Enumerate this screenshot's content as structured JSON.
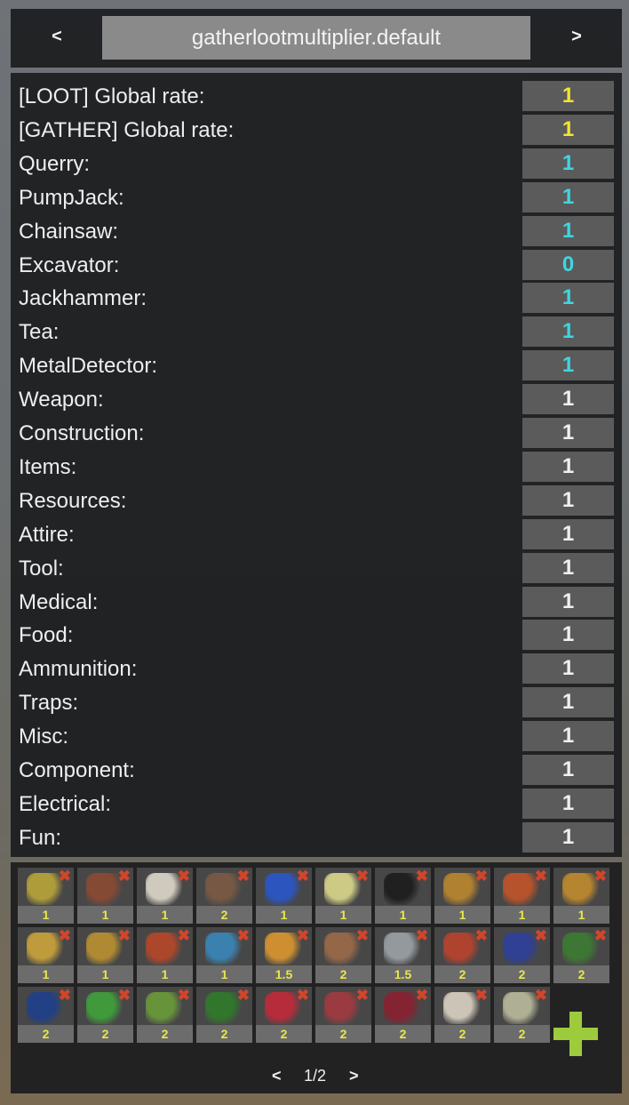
{
  "header": {
    "prev": "<",
    "title": "gatherlootmultiplier.default",
    "next": ">"
  },
  "colors": {
    "yellow": "#f2e433",
    "cyan": "#3fd6e0",
    "white": "#f0f0f0",
    "accent_add": "#9ccb3c",
    "qty_text": "#e8e74a",
    "remove": "#d2452b"
  },
  "rates": [
    {
      "label": "[LOOT] Global rate:",
      "value": "1",
      "color": "yellow"
    },
    {
      "label": "[GATHER] Global rate:",
      "value": "1",
      "color": "yellow"
    },
    {
      "label": "Querry:",
      "value": "1",
      "color": "cyan"
    },
    {
      "label": "PumpJack:",
      "value": "1",
      "color": "cyan"
    },
    {
      "label": "Chainsaw:",
      "value": "1",
      "color": "cyan"
    },
    {
      "label": "Excavator:",
      "value": "0",
      "color": "cyan"
    },
    {
      "label": "Jackhammer:",
      "value": "1",
      "color": "cyan"
    },
    {
      "label": "Tea:",
      "value": "1",
      "color": "cyan"
    },
    {
      "label": "MetalDetector:",
      "value": "1",
      "color": "cyan"
    },
    {
      "label": "Weapon:",
      "value": "1",
      "color": "white"
    },
    {
      "label": "Construction:",
      "value": "1",
      "color": "white"
    },
    {
      "label": "Items:",
      "value": "1",
      "color": "white"
    },
    {
      "label": "Resources:",
      "value": "1",
      "color": "white"
    },
    {
      "label": "Attire:",
      "value": "1",
      "color": "white"
    },
    {
      "label": "Tool:",
      "value": "1",
      "color": "white"
    },
    {
      "label": "Medical:",
      "value": "1",
      "color": "white"
    },
    {
      "label": "Food:",
      "value": "1",
      "color": "white"
    },
    {
      "label": "Ammunition:",
      "value": "1",
      "color": "white"
    },
    {
      "label": "Traps:",
      "value": "1",
      "color": "white"
    },
    {
      "label": "Misc:",
      "value": "1",
      "color": "white"
    },
    {
      "label": "Component:",
      "value": "1",
      "color": "white"
    },
    {
      "label": "Electrical:",
      "value": "1",
      "color": "white"
    },
    {
      "label": "Fun:",
      "value": "1",
      "color": "white"
    }
  ],
  "items": [
    {
      "icon": "seeds-pile-icon",
      "qty": "1",
      "color": "#b7a43a"
    },
    {
      "icon": "bear-skull-icon",
      "qty": "1",
      "color": "#8a4a33"
    },
    {
      "icon": "human-skull-icon",
      "qty": "1",
      "color": "#dcd6c8"
    },
    {
      "icon": "gears-icon",
      "qty": "2",
      "color": "#7a5a44"
    },
    {
      "icon": "blue-jerry-can-icon",
      "qty": "1",
      "color": "#2a56c9"
    },
    {
      "icon": "water-bottle-icon",
      "qty": "1",
      "color": "#d9d58a"
    },
    {
      "icon": "oil-barrel-icon",
      "qty": "1",
      "color": "#1c1c1c"
    },
    {
      "icon": "pistol-bullet-icon",
      "qty": "1",
      "color": "#b9862e"
    },
    {
      "icon": "incendiary-bullet-icon",
      "qty": "1",
      "color": "#c0542a"
    },
    {
      "icon": "hv-bullet-icon",
      "qty": "1",
      "color": "#c08a2e"
    },
    {
      "icon": "rifle-ammo-icon",
      "qty": "1",
      "color": "#c9a23a"
    },
    {
      "icon": "explosive-rifle-ammo-icon",
      "qty": "1",
      "color": "#b99030"
    },
    {
      "icon": "incendiary-rifle-ammo-icon",
      "qty": "1",
      "color": "#b5472a"
    },
    {
      "icon": "hv-rifle-ammo-icon",
      "qty": "1",
      "color": "#3a86b8"
    },
    {
      "icon": "anti-rad-pills-icon",
      "qty": "1.5",
      "color": "#d9952e"
    },
    {
      "icon": "cloth-bandage-icon",
      "qty": "2",
      "color": "#9a6a48"
    },
    {
      "icon": "metal-ore-icon",
      "qty": "1.5",
      "color": "#9aa0a6"
    },
    {
      "icon": "mushroom-icon",
      "qty": "2",
      "color": "#b8432e"
    },
    {
      "icon": "blueberries-icon",
      "qty": "2",
      "color": "#2e3f9a"
    },
    {
      "icon": "blue-berry-plant-icon",
      "qty": "2",
      "color": "#3d7a33"
    },
    {
      "icon": "blue-berry-seeds-icon",
      "qty": "2",
      "color": "#1e3f8a"
    },
    {
      "icon": "green-berry-plant-icon",
      "qty": "2",
      "color": "#3fa03a"
    },
    {
      "icon": "green-berry-clone-icon",
      "qty": "2",
      "color": "#6a9a3a"
    },
    {
      "icon": "green-berries-icon",
      "qty": "2",
      "color": "#2f7a2a"
    },
    {
      "icon": "red-berries-icon",
      "qty": "2",
      "color": "#c02a3a"
    },
    {
      "icon": "red-berry-plant-icon",
      "qty": "2",
      "color": "#a03a40"
    },
    {
      "icon": "red-berry-seeds-icon",
      "qty": "2",
      "color": "#8a2030"
    },
    {
      "icon": "white-berry-plant-icon",
      "qty": "2",
      "color": "#d8cfc0"
    },
    {
      "icon": "white-berry-clone-icon",
      "qty": "2",
      "color": "#b7b89a"
    }
  ],
  "remove_glyph": "✖",
  "pager": {
    "prev": "<",
    "label": "1/2",
    "next": ">"
  }
}
